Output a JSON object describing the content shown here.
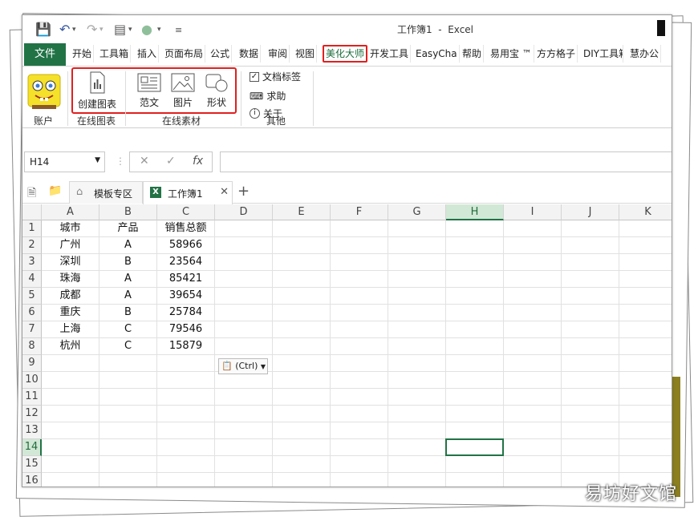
{
  "window": {
    "title": "工作簿1  -  Excel"
  },
  "quick_access": [
    "save-icon",
    "undo-icon",
    "redo-icon",
    "form-icon",
    "circle-icon",
    "customize-icon"
  ],
  "tabs": [
    "文件",
    "开始",
    "工具箱",
    "插入",
    "页面布局",
    "公式",
    "数据",
    "审阅",
    "视图",
    "美化大师",
    "开发工具",
    "EasyCha",
    "帮助",
    "易用宝 ™",
    "方方格子",
    "DIY工具箱",
    "慧办公"
  ],
  "active_tab": "美化大师",
  "ribbon": {
    "account_label": "账户",
    "create_chart": "创建图表",
    "template_text": "范文",
    "picture": "图片",
    "shape": "形状",
    "groups": [
      "在线图表",
      "在线素材",
      "其他"
    ],
    "other_items": [
      "文档标签",
      "求助",
      "关于"
    ]
  },
  "name_box": "H14",
  "doc_tabs": {
    "template_zone": "模板专区",
    "workbook": "工作簿1"
  },
  "columns": [
    "A",
    "B",
    "C",
    "D",
    "E",
    "F",
    "G",
    "H",
    "I",
    "J",
    "K"
  ],
  "rows": [
    "1",
    "2",
    "3",
    "4",
    "5",
    "6",
    "7",
    "8",
    "9",
    "10",
    "11",
    "12",
    "13",
    "14",
    "15",
    "16"
  ],
  "table": {
    "headers": [
      "城市",
      "产品",
      "销售总额"
    ],
    "data": [
      [
        "广州",
        "A",
        "58966"
      ],
      [
        "深圳",
        "B",
        "23564"
      ],
      [
        "珠海",
        "A",
        "85421"
      ],
      [
        "成都",
        "A",
        "39654"
      ],
      [
        "重庆",
        "B",
        "25784"
      ],
      [
        "上海",
        "C",
        "79546"
      ],
      [
        "杭州",
        "C",
        "15879"
      ]
    ]
  },
  "selected_cell": "H14",
  "paste_options": "(Ctrl)",
  "watermark": "易坊好文馆",
  "colors": {
    "excel_green": "#217346",
    "highlight_red": "#e02020",
    "selected_header": "#d2e8d6"
  }
}
